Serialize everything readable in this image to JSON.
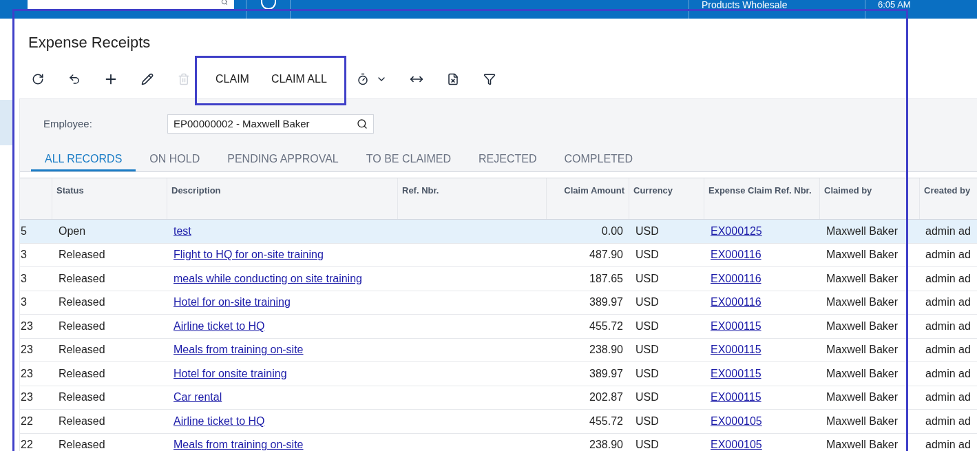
{
  "top_bar": {
    "company": "Products Wholesale",
    "time": "6:05 AM"
  },
  "title": "Expense Receipts",
  "toolbar": {
    "actions": [
      "CLAIM",
      "CLAIM ALL"
    ]
  },
  "filter": {
    "label": "Employee:",
    "value": "EP00000002 - Maxwell Baker"
  },
  "tabs": [
    {
      "label": "ALL RECORDS",
      "selected": true
    },
    {
      "label": "ON HOLD",
      "selected": false
    },
    {
      "label": "PENDING APPROVAL",
      "selected": false
    },
    {
      "label": "TO BE CLAIMED",
      "selected": false
    },
    {
      "label": "REJECTED",
      "selected": false
    },
    {
      "label": "COMPLETED",
      "selected": false
    }
  ],
  "table": {
    "columns": [
      "",
      "Status",
      "Description",
      "Ref. Nbr.",
      "Claim Amount",
      "Currency",
      "Expense Claim Ref. Nbr.",
      "Claimed by",
      "Created by"
    ],
    "rows": [
      {
        "selected": true,
        "cells": [
          "5",
          "Open",
          "test",
          "",
          "0.00",
          "USD",
          "EX000125",
          "Maxwell Baker",
          "admin ad"
        ]
      },
      {
        "selected": false,
        "cells": [
          "3",
          "Released",
          "Flight to HQ for on-site training",
          "",
          "487.90",
          "USD",
          "EX000116",
          "Maxwell Baker",
          "admin ad"
        ]
      },
      {
        "selected": false,
        "cells": [
          "3",
          "Released",
          "meals while conducting on site training",
          "",
          "187.65",
          "USD",
          "EX000116",
          "Maxwell Baker",
          "admin ad"
        ]
      },
      {
        "selected": false,
        "cells": [
          "3",
          "Released",
          "Hotel for on-site training",
          "",
          "389.97",
          "USD",
          "EX000116",
          "Maxwell Baker",
          "admin ad"
        ]
      },
      {
        "selected": false,
        "cells": [
          "23",
          "Released",
          "Airline ticket to HQ",
          "",
          "455.72",
          "USD",
          "EX000115",
          "Maxwell Baker",
          "admin ad"
        ]
      },
      {
        "selected": false,
        "cells": [
          "23",
          "Released",
          "Meals from training on-site",
          "",
          "238.90",
          "USD",
          "EX000115",
          "Maxwell Baker",
          "admin ad"
        ]
      },
      {
        "selected": false,
        "cells": [
          "23",
          "Released",
          "Hotel for onsite training",
          "",
          "389.97",
          "USD",
          "EX000115",
          "Maxwell Baker",
          "admin ad"
        ]
      },
      {
        "selected": false,
        "cells": [
          "23",
          "Released",
          "Car rental",
          "",
          "202.87",
          "USD",
          "EX000115",
          "Maxwell Baker",
          "admin ad"
        ]
      },
      {
        "selected": false,
        "cells": [
          "22",
          "Released",
          "Airline ticket to HQ",
          "",
          "455.72",
          "USD",
          "EX000105",
          "Maxwell Baker",
          "admin ad"
        ]
      },
      {
        "selected": false,
        "cells": [
          "22",
          "Released",
          "Meals from training on-site",
          "",
          "238.90",
          "USD",
          "EX000105",
          "Maxwell Baker",
          "admin ad"
        ]
      }
    ]
  }
}
